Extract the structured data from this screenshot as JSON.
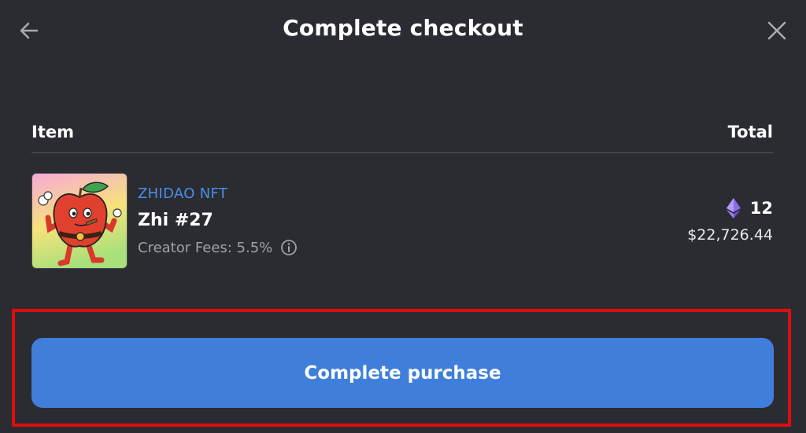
{
  "header": {
    "title": "Complete checkout",
    "back_icon": "arrow-left-icon",
    "close_icon": "close-icon"
  },
  "table": {
    "col_item": "Item",
    "col_total": "Total"
  },
  "item": {
    "collection": "ZHIDAO NFT",
    "name": "Zhi #27",
    "creator_fees": "Creator Fees: 5.5%",
    "price_eth": "12",
    "price_usd": "$22,726.44",
    "currency_icon": "ethereum-icon",
    "info_icon": "info-icon"
  },
  "action": {
    "purchase_label": "Complete purchase"
  },
  "colors": {
    "background": "#2a2c31",
    "accent": "#3f7fdb",
    "collection_link": "#4c8ee8",
    "highlight": "#e00d0d"
  }
}
